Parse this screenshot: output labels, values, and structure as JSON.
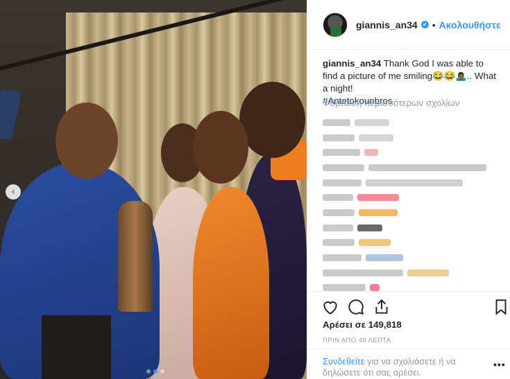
{
  "post": {
    "username": "giannis_an34",
    "verified_icon": "✔",
    "separator": "•",
    "follow_label": "Ακολουθήστε",
    "caption_text": "Thank God I was able to find a picture of me smiling😂😂🙇🏾‍♂️.. What a night!",
    "caption_tag": "#Antetokounbros",
    "load_more": "Φόρτωση περισσότερων σχολίων",
    "likes": "Αρέσει σε 149,818",
    "time": "ΠΡΙΝ ΑΠΟ 49 ΛΕΠΤΑ",
    "login_link": "Συνδεθείτε",
    "login_rest": " για να σχολιάσετε ή να δηλώσετε ότι σας αρέσει.",
    "more_label": "•••"
  },
  "carousel": {
    "prev_arrow": "‹",
    "slide_count": 3,
    "active_slide": 2
  },
  "comments": [
    {
      "user_blur": 40,
      "text_blur": 50,
      "color": "#c9c9c9"
    },
    {
      "user_blur": 46,
      "text_blur": 50,
      "color": "#cccccc"
    },
    {
      "user_blur": 54,
      "text_blur": 20,
      "color": "#e9a4a8"
    },
    {
      "user_blur": 60,
      "text_blur": 170,
      "color": "#bdbdbd"
    },
    {
      "user_blur": 56,
      "text_blur": 140,
      "color": "#c3c3c3"
    },
    {
      "user_blur": 44,
      "text_blur": 60,
      "color": "#f06f81"
    },
    {
      "user_blur": 46,
      "text_blur": 56,
      "color": "#f2a53b"
    },
    {
      "user_blur": 44,
      "text_blur": 36,
      "color": "#444444"
    },
    {
      "user_blur": 46,
      "text_blur": 46,
      "color": "#f4b94a"
    },
    {
      "user_blur": 56,
      "text_blur": 54,
      "color": "#9ab7d6"
    },
    {
      "user_blur": 116,
      "text_blur": 60,
      "color": "#e8c27a"
    },
    {
      "user_blur": 62,
      "text_blur": 14,
      "color": "#e86171"
    }
  ],
  "icons": {
    "heart": "heart-icon",
    "comment": "comment-icon",
    "share": "share-icon",
    "save": "bookmark-icon"
  }
}
